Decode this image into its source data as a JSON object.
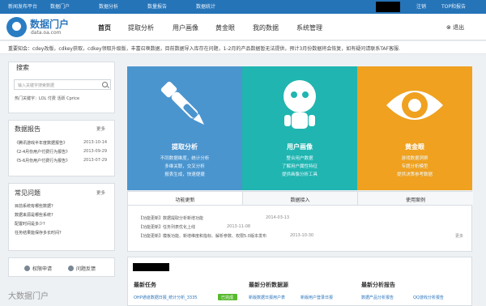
{
  "topbar": {
    "items": [
      "新闻发布平台",
      "数据门户",
      "数据分析",
      "数量报告",
      "数据统计"
    ],
    "right_items": [
      "注销",
      "TOP和报告"
    ]
  },
  "header": {
    "title": "数据门户",
    "subtitle": "data.oa.com",
    "nav": [
      "首页",
      "提取分析",
      "用户画像",
      "黄金眼",
      "我的数据",
      "系统管理"
    ],
    "logout": "⊗ 退出"
  },
  "notice": {
    "text": "重要知会：cdey改版，cdkey获取，cdkey领取升级版，丰富召唤数据，目前数据导入库存在问题，1-2月的产品数据暂无法提供，预计3月份数据将会恢复，如有疑问请联系TAF客服."
  },
  "search": {
    "title": "搜索",
    "placeholder": "输入关键字搜索数据",
    "hotwords": "热门关键字：LOL  付费  活跃  Cprice"
  },
  "reports": {
    "title": "数据报告",
    "more": "更多",
    "items": [
      {
        "name": "《腾讯游戏半年度数据报告》",
        "date": "2013-10-14"
      },
      {
        "name": "《2-4月份用户付费行为报告》",
        "date": "2013-09-29"
      },
      {
        "name": "《5-6月份用户付费行为报告》",
        "date": "2013-07-29"
      }
    ]
  },
  "faq": {
    "title": "常见问题",
    "more": "更多",
    "items": [
      "目前系统有哪些数据?",
      "数据来源是哪些系统?",
      "配置时间是多少?",
      "任务结果能保存多长时间?"
    ]
  },
  "links": {
    "apply": "权限申请",
    "feedback": "问题反馈"
  },
  "features": [
    {
      "title": "提取分析",
      "lines": [
        "不同数据维度，统计分析",
        "多维关联，交叉分析",
        "报表生成，快速便捷"
      ],
      "color": "#4b95cf"
    },
    {
      "title": "用户画像",
      "lines": [
        "整合用户数据",
        "了解用户属性特征",
        "提供画像分析工具"
      ],
      "color": "#20b5b0"
    },
    {
      "title": "黄金眼",
      "lines": [
        "游戏数据洞察",
        "专题分析模型",
        "提供决策参考数据"
      ],
      "color": "#efa11f"
    }
  ],
  "tabs": [
    "功能更新",
    "数据接入",
    "使用案例"
  ],
  "updates": {
    "rows": [
      {
        "text": "【功能更新】数据提取分析新增功能",
        "date": "2014-03-13"
      },
      {
        "text": "【功能更新】任务列表优化上线",
        "date": "2013-11-08"
      },
      {
        "text": "【功能更新】模板功能、新增维度和指标、解析参数、权限5.0版本发布",
        "date": "2013-10-30"
      }
    ],
    "more": "更多"
  },
  "bottom_sections": [
    {
      "title": "最新任务",
      "item": "OHP通道数据日报_统计分析_3335",
      "badge": "已完成"
    },
    {
      "title": "最新分析数据源",
      "item": "新版数据日报用户表",
      "item2": "新版用户登录日报"
    },
    {
      "title": "最新分析报告",
      "item": "数据产品分析报告",
      "item2": "QQ游戏分析报告"
    }
  ],
  "watermark": "大数据门户"
}
